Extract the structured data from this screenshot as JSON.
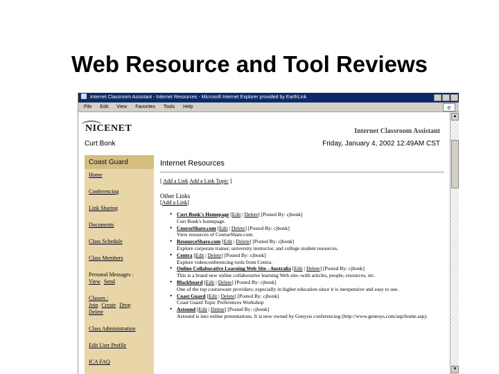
{
  "slide": {
    "title": "Web Resource and Tool Reviews"
  },
  "window": {
    "title": "Internet Classroom Assistant - Internet Resources - Microsoft Internet Explorer provided by EarthLink"
  },
  "menu": [
    "File",
    "Edit",
    "View",
    "Favorites",
    "Tools",
    "Help"
  ],
  "header": {
    "logo": "NICENET",
    "app_name": "Internet Classroom Assistant",
    "user": "Curt Bonk",
    "datetime": "Friday, January 4, 2002 12:49AM CST"
  },
  "sidebar": {
    "class_name": "Coast Guard",
    "items": [
      "Home",
      "Conferencing",
      "Link Sharing",
      "Documents",
      "Class Schedule",
      "Class Members"
    ],
    "personal_messages": {
      "label": "Personal Messages :",
      "view": "View",
      "send": "Send"
    },
    "classes": {
      "label": "Classes :",
      "join": "Join",
      "create": "Create",
      "drop": "Drop",
      "delete": "Delete"
    },
    "items_bottom": [
      "Class Administration",
      "Edit User Profile",
      "ICA FAQ"
    ]
  },
  "main": {
    "section_title": "Internet Resources",
    "add_link": "Add a Link",
    "add_link_topic": "Add a Link Topic",
    "other_links": "Other Links",
    "other_add_link": "Add a Link",
    "edit_label": "Edit",
    "delete_label": "Delete",
    "links": [
      {
        "title": "Curt Bonk's Homepage",
        "posted": "[Posted By: cjbonk]",
        "desc": "Curt Bonk's homepage."
      },
      {
        "title": "CourseShare.com",
        "posted": "[Posted By: cjbonk]",
        "desc": "View resources of CourseShare.com."
      },
      {
        "title": "ResourceShare.com",
        "posted": "[Posted By: cjbonk]",
        "desc": "Explore corporate trainer, university instructor, and college student resources."
      },
      {
        "title": "Centra",
        "posted": "[Posted By: cjbonk]",
        "desc": "Explore videoconferencing tools from Centra."
      },
      {
        "title": "Online Collaborative Learning Web Site - Australia",
        "posted": "[Posted By: cjbonk]",
        "desc": "This is a brand new online collaborative learning Web site--with articles, people, resources, etc."
      },
      {
        "title": "Blackboard",
        "posted": "[Posted By: cjbonk]",
        "desc": "One of the top courseware providers; especially in higher education since it is inexpensive and easy to use."
      },
      {
        "title": "Coast Guard",
        "posted": "[Posted By: cjbonk]",
        "desc": "Coast Guard Topic Preferences Workshop"
      },
      {
        "title": "Astound",
        "posted": "[Posted By: cjbonk]",
        "desc": "Astound is into online presentations. It is now owned by Genysis conferencing (http://www.genesys.com/asp/home.asp)."
      }
    ]
  }
}
